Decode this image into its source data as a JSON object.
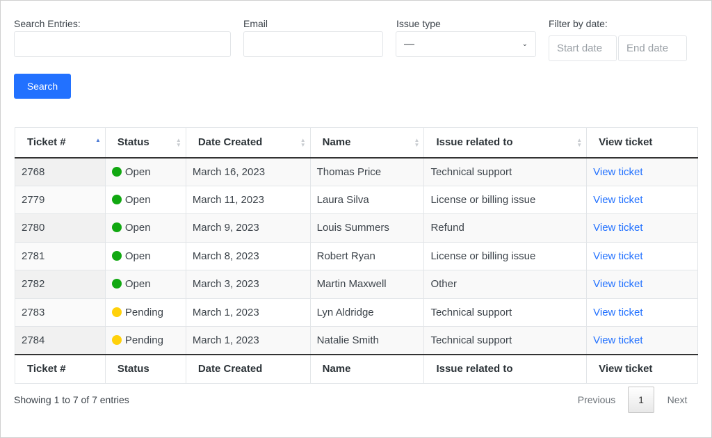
{
  "filters": {
    "search_label": "Search Entries:",
    "email_label": "Email",
    "issue_label": "Issue type",
    "issue_value": "—",
    "date_label": "Filter by date:",
    "start_placeholder": "Start date",
    "end_placeholder": "End date",
    "search_button": "Search"
  },
  "table": {
    "columns": [
      "Ticket #",
      "Status",
      "Date Created",
      "Name",
      "Issue related to",
      "View ticket"
    ],
    "sorted_column": "Ticket #",
    "sort_direction": "ascending",
    "status_colors": {
      "Open": "#11a811",
      "Pending": "#ffd10a"
    },
    "rows": [
      [
        "2768",
        "Open",
        "March 16, 2023",
        "Thomas Price",
        "Technical support",
        "View ticket"
      ],
      [
        "2779",
        "Open",
        "March 11, 2023",
        "Laura Silva",
        "License or billing issue",
        "View ticket"
      ],
      [
        "2780",
        "Open",
        "March 9, 2023",
        "Louis Summers",
        "Refund",
        "View ticket"
      ],
      [
        "2781",
        "Open",
        "March 8, 2023",
        "Robert Ryan",
        "License or billing issue",
        "View ticket"
      ],
      [
        "2782",
        "Open",
        "March 3, 2023",
        "Martin Maxwell",
        "Other",
        "View ticket"
      ],
      [
        "2783",
        "Pending",
        "March 1, 2023",
        "Lyn Aldridge",
        "Technical support",
        "View ticket"
      ],
      [
        "2784",
        "Pending",
        "March 1, 2023",
        "Natalie Smith",
        "Technical support",
        "View ticket"
      ]
    ]
  },
  "footer": {
    "info": "Showing 1 to 7 of 7 entries",
    "previous": "Previous",
    "page": "1",
    "next": "Next"
  }
}
